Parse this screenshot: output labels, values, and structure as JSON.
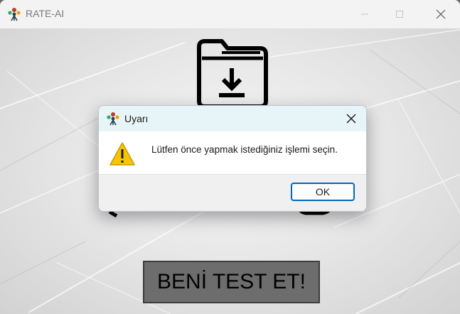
{
  "window": {
    "title": "RATE-AI"
  },
  "main": {
    "test_button_label": "BENİ TEST ET!"
  },
  "dialog": {
    "title": "Uyarı",
    "message": "Lütfen önce yapmak istediğiniz işlemi seçin.",
    "ok_label": "OK"
  },
  "icons": {
    "app": "rate-ai-app-icon",
    "folder": "folder-download-icon",
    "warning": "warning-triangle-icon"
  },
  "colors": {
    "dialog_accent": "#0067c0",
    "test_button_bg": "#6d6d6d",
    "warning_yellow": "#f7c600"
  }
}
